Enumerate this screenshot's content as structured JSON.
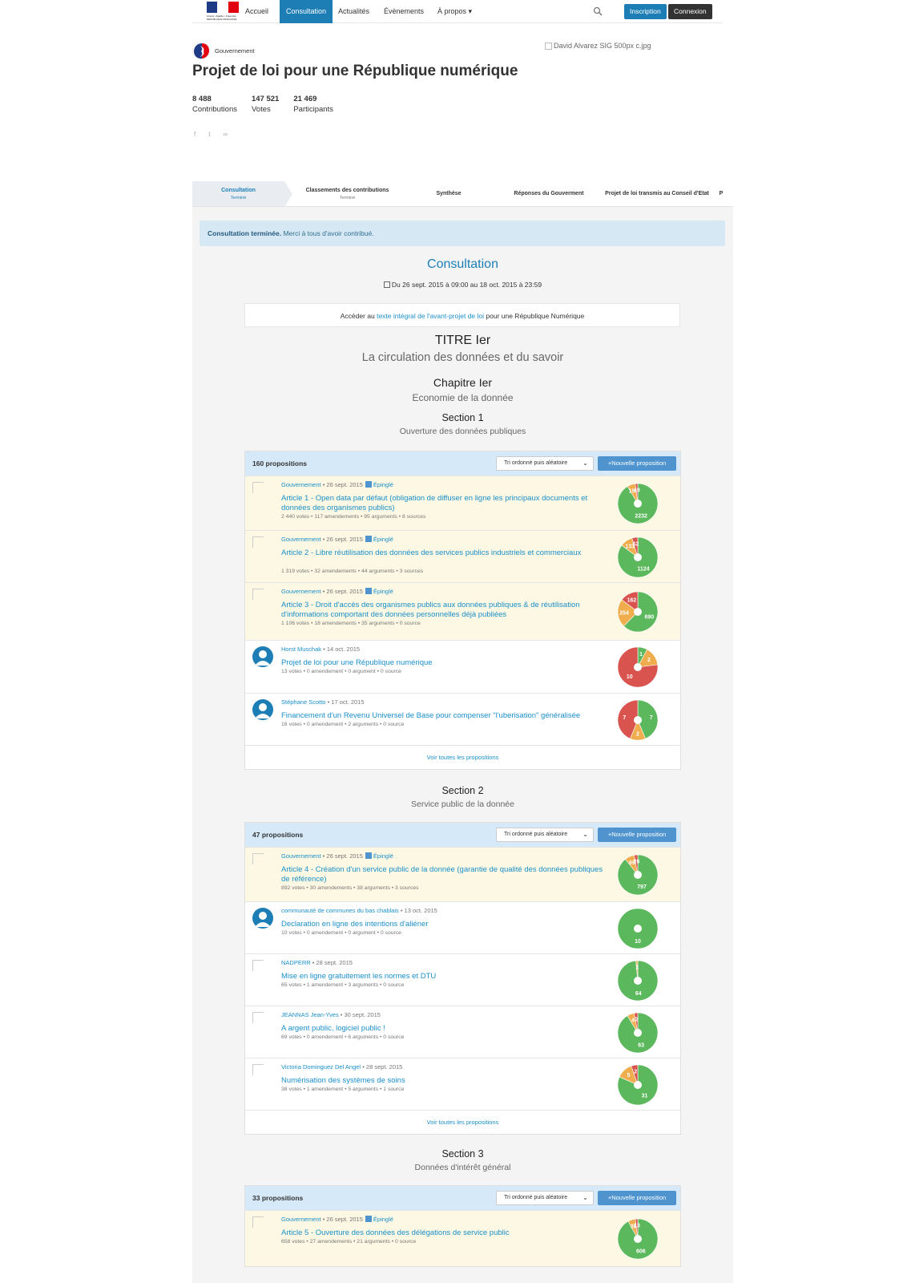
{
  "nav": {
    "logo_text": "Liberté • Égalité • Fraternité RÉPUBLIQUE FRANÇAISE",
    "items": [
      "Accueil",
      "Consultation",
      "Actualités",
      "Évènements",
      "À propos ▾"
    ],
    "signup": "Inscription",
    "login": "Connexion",
    "flag_colors": [
      "#1f3b86",
      "#ffffff",
      "#e1000f"
    ]
  },
  "header": {
    "org": "Gouvernement",
    "cover_alt": "David Alvarez SIG 500px c.jpg",
    "title": "Projet de loi pour une République numérique",
    "stats": [
      {
        "num": "8 488",
        "label": "Contributions"
      },
      {
        "num": "147 521",
        "label": "Votes"
      },
      {
        "num": "21 469",
        "label": "Participants"
      }
    ],
    "share": [
      "f",
      "t",
      "∞"
    ]
  },
  "steps": [
    {
      "label": "Consultation",
      "sub": "Terminé"
    },
    {
      "label": "Classements des contributions",
      "sub": "Terminé"
    },
    {
      "label": "Synthèse",
      "sub": ""
    },
    {
      "label": "Réponses du Gouverment",
      "sub": ""
    },
    {
      "label": "Projet de loi transmis au Conseil d'Etat",
      "sub": ""
    },
    {
      "label": "P",
      "sub": ""
    }
  ],
  "alert": {
    "bold": "Consultation terminée.",
    "text": " Merci à tous d'avoir contribué."
  },
  "consultation": {
    "title": "Consultation",
    "dates": "Du 26 sept. 2015 à 09:00 au 18 oct. 2015 à 23:59",
    "access_pre": "Accéder au ",
    "access_link": "texte intégral de l'avant-projet de loi",
    "access_post": " pour une République Numérique"
  },
  "titre": {
    "label": "TITRE Ier",
    "name": "La circulation des données et du savoir"
  },
  "chapitre": {
    "label": "Chapitre Ier",
    "name": "Economie de la donnée"
  },
  "sort_label": "Tri ordonné puis aléatoire",
  "new_label": "Nouvelle proposition",
  "see_all": "Voir toutes les propositions",
  "pinned_label": "Épinglé",
  "vote_colors": {
    "for": "#5cb85c",
    "mixed": "#f0ad4e",
    "against": "#d9534f"
  },
  "sections": [
    {
      "label": "Section 1",
      "name": "Ouverture des données publiques",
      "count": "160 propositions",
      "proposals": [
        {
          "author": "Gouvernement",
          "date": "• 26 sept. 2015",
          "pinned": true,
          "avatar": "placeholder",
          "title": "Article 1 - Open data par défaut (obligation de diffuser en ligne les principaux documents et données des organismes publics)",
          "counts": "2 440 votes • 117 amendements • 95 arguments • 8 sources",
          "votes": {
            "for": 2232,
            "mixed": 159,
            "against": 49
          }
        },
        {
          "author": "Gouvernement",
          "date": "• 26 sept. 2015",
          "pinned": true,
          "avatar": "placeholder",
          "title": "Article 2 - Libre réutilisation des données des services publics industriels et commerciaux",
          "counts": "1 319 votes • 32 amendements • 44 arguments • 3 sources",
          "votes": {
            "for": 1124,
            "mixed": 133,
            "against": 62
          }
        },
        {
          "author": "Gouvernement",
          "date": "• 26 sept. 2015",
          "pinned": true,
          "avatar": "placeholder",
          "title": "Article 3 - Droit d'accès des organismes publics aux données publiques & de réutilisation d'informations comportant des données personnelles déjà publiées",
          "counts": "1 106 votes • 18 amendements • 35 arguments • 0 source",
          "votes": {
            "for": 690,
            "mixed": 254,
            "against": 162
          }
        },
        {
          "author": "Horst Muschak",
          "date": "• 14 oct. 2015",
          "pinned": false,
          "avatar": "user",
          "title": "Projet de loi pour une République numérique",
          "counts": "13 votes • 0 amendement • 0 argument • 0 source",
          "votes": {
            "for": 1,
            "mixed": 2,
            "against": 10
          }
        },
        {
          "author": "Stéphane Scotto",
          "date": "• 17 oct. 2015",
          "pinned": false,
          "avatar": "user",
          "title": "Financement d'un Revenu Universel de Base pour compenser \"l'uberisation\" généralisée",
          "counts": "16 votes • 0 amendement • 2 arguments • 0 source",
          "votes": {
            "for": 7,
            "mixed": 2,
            "against": 7
          }
        }
      ]
    },
    {
      "label": "Section 2",
      "name": "Service public de la donnée",
      "count": "47 propositions",
      "proposals": [
        {
          "author": "Gouvernement",
          "date": "• 26 sept. 2015",
          "pinned": true,
          "avatar": "placeholder",
          "title": "Article 4 - Création d'un service public de la donnée (garantie de qualité des données publiques de référence)",
          "counts": "892 votes • 30 amendements • 38 arguments • 3 sources",
          "votes": {
            "for": 797,
            "mixed": 69,
            "against": 26
          }
        },
        {
          "author": "communauté de communes du bas chablais",
          "date": "• 13 oct. 2015",
          "pinned": false,
          "avatar": "user",
          "title": "Declaration en ligne des intentions d'aliéner",
          "counts": "10 votes • 0 amendement • 0 argument • 0 source",
          "votes": {
            "for": 10,
            "mixed": 0,
            "against": 0
          }
        },
        {
          "author": "NADPERR",
          "date": "• 28 sept. 2015",
          "pinned": false,
          "avatar": "placeholder",
          "title": "Mise en ligne gratuitement les normes et DTU",
          "counts": "65 votes • 1 amendement • 3 arguments • 0 source",
          "votes": {
            "for": 64,
            "mixed": 1,
            "against": 0
          }
        },
        {
          "author": "JEANNAS Jean-Yves",
          "date": "• 30 sept. 2015",
          "pinned": false,
          "avatar": "placeholder",
          "title": "A argent public, logiciel public !",
          "counts": "69 votes • 0 amendement • 6 arguments • 0 source",
          "votes": {
            "for": 63,
            "mixed": 4,
            "against": 2
          }
        },
        {
          "author": "Victoria Dominguez Del Angel",
          "date": "• 28 sept. 2015",
          "pinned": false,
          "avatar": "placeholder",
          "title": "Numérisation des systèmes de soins",
          "counts": "38 votes • 1 amendement • 5 arguments • 1 source",
          "votes": {
            "for": 31,
            "mixed": 5,
            "against": 2
          }
        }
      ]
    },
    {
      "label": "Section 3",
      "name": "Données d'intérêt général",
      "count": "33 propositions",
      "proposals": [
        {
          "author": "Gouvernement",
          "date": "• 26 sept. 2015",
          "pinned": true,
          "avatar": "placeholder",
          "title": "Article 5 - Ouverture des données des délégations de service public",
          "counts": "658 votes • 27 amendements • 21 arguments • 0 source",
          "votes": {
            "for": 606,
            "mixed": 39,
            "against": 13
          }
        }
      ]
    }
  ]
}
